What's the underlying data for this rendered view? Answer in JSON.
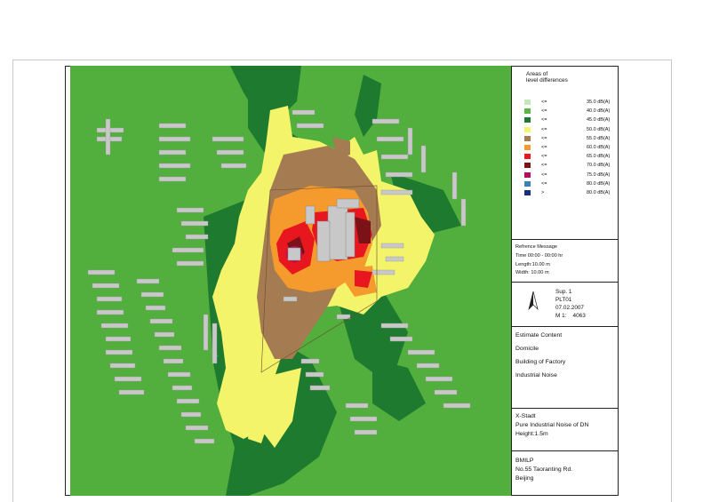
{
  "legend": {
    "title_line1": "Areas of",
    "title_line2": "level differences",
    "items": [
      {
        "op": "<=",
        "value": "35.0 dB(A)",
        "color": "#c3e6bb"
      },
      {
        "op": "<=",
        "value": "40.0 dB(A)",
        "color": "#5bb548"
      },
      {
        "op": "<=",
        "value": "45.0 dB(A)",
        "color": "#1e7a2e"
      },
      {
        "op": "<=",
        "value": "50.0 dB(A)",
        "color": "#f4f46a"
      },
      {
        "op": "<=",
        "value": "55.0 dB(A)",
        "color": "#a57c52"
      },
      {
        "op": "<=",
        "value": "60.0 dB(A)",
        "color": "#f59a2c"
      },
      {
        "op": "<=",
        "value": "65.0 dB(A)",
        "color": "#e8161e"
      },
      {
        "op": "<=",
        "value": "70.0 dB(A)",
        "color": "#7a1218"
      },
      {
        "op": "<=",
        "value": "75.0 dB(A)",
        "color": "#b0105e"
      },
      {
        "op": "<=",
        "value": "80.0 dB(A)",
        "color": "#3b82b8"
      },
      {
        "op": ">",
        "value": "80.0 dB(A)",
        "color": "#16307a"
      }
    ]
  },
  "reference": {
    "title": "Refrence Message",
    "time": "Time 00:00 - 00:00 hr",
    "length": "Length:10.00 m",
    "width": "Width: 10.00 m"
  },
  "sheet": {
    "sup": "Sup. 1",
    "plt": "PLT01",
    "date": "07.02.2007",
    "scale": "M 1:    4063"
  },
  "estimate": {
    "title": "Estimate Content",
    "items": [
      "Domicile",
      "Building of Factory",
      "Industrial Noise"
    ]
  },
  "project": {
    "line1": "X-Stadt",
    "line2": "Pure Industrial Noise of DN",
    "line3": "Height:1.5m"
  },
  "company": {
    "line1": "BMILP",
    "line2": "No.55 Taoranting Rd.",
    "line3": "Beijing"
  },
  "icons": {
    "north_arrow": "north-arrow-icon"
  }
}
